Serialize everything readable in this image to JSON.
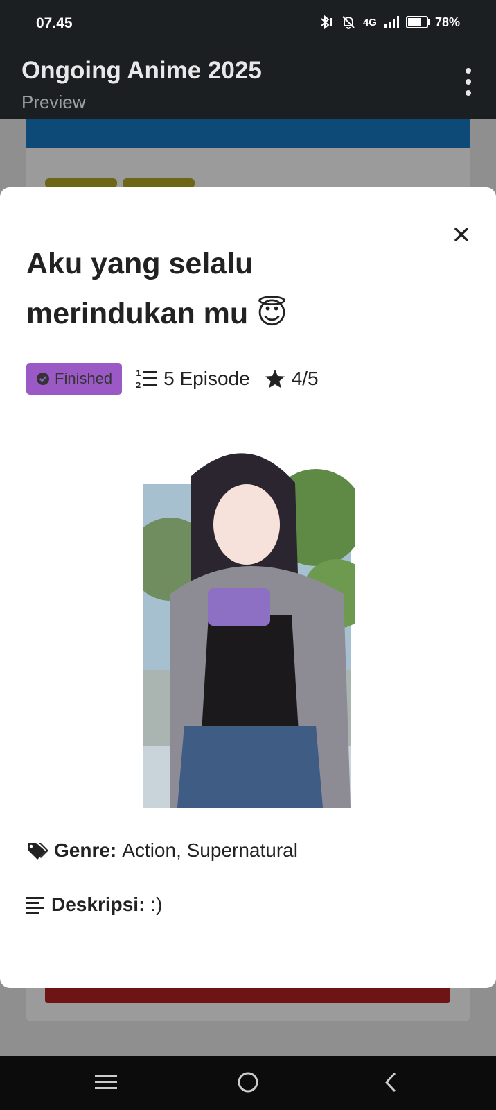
{
  "status_bar": {
    "time": "07.45",
    "network": "4G",
    "battery": "78%",
    "battery_level": 0.78,
    "icons": [
      "bluetooth-icon",
      "bell-off-icon",
      "signal-icon",
      "battery-icon"
    ]
  },
  "app_bar": {
    "title": "Ongoing Anime 2025",
    "subtitle": "Preview",
    "menu_icon": "more-vert-icon"
  },
  "modal": {
    "title": "Aku yang selalu merindukan mu 😇",
    "status_badge": "Finished",
    "episodes": "5 Episode",
    "rating": "4/5",
    "genre_label": "Genre:",
    "genre_value": "Action, Supernatural",
    "desc_label": "Deskripsi:",
    "desc_value": ":)",
    "colors": {
      "badge": "#9b59c6",
      "text": "#222222"
    }
  },
  "nav_bar": {
    "buttons": [
      "menu-icon",
      "home-icon",
      "back-icon"
    ]
  }
}
